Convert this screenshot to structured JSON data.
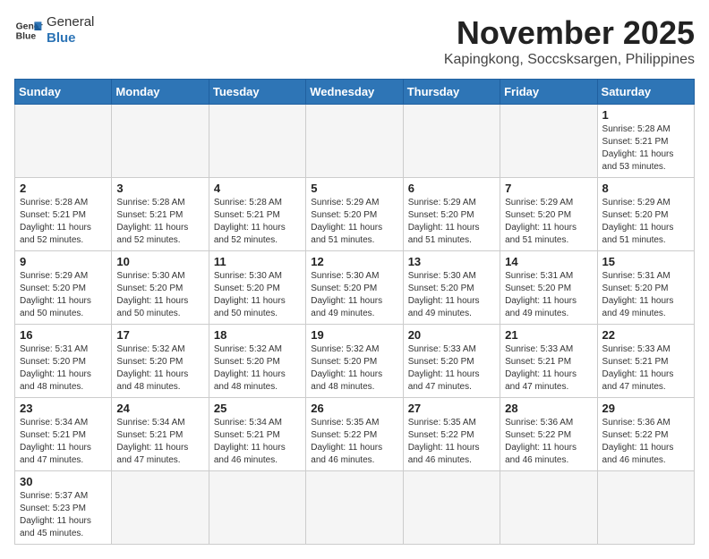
{
  "header": {
    "logo_text_normal": "General",
    "logo_text_bold": "Blue",
    "month_title": "November 2025",
    "location": "Kapingkong, Soccsksargen, Philippines"
  },
  "weekdays": [
    "Sunday",
    "Monday",
    "Tuesday",
    "Wednesday",
    "Thursday",
    "Friday",
    "Saturday"
  ],
  "weeks": [
    [
      {
        "day": "",
        "info": ""
      },
      {
        "day": "",
        "info": ""
      },
      {
        "day": "",
        "info": ""
      },
      {
        "day": "",
        "info": ""
      },
      {
        "day": "",
        "info": ""
      },
      {
        "day": "",
        "info": ""
      },
      {
        "day": "1",
        "info": "Sunrise: 5:28 AM\nSunset: 5:21 PM\nDaylight: 11 hours\nand 53 minutes."
      }
    ],
    [
      {
        "day": "2",
        "info": "Sunrise: 5:28 AM\nSunset: 5:21 PM\nDaylight: 11 hours\nand 52 minutes."
      },
      {
        "day": "3",
        "info": "Sunrise: 5:28 AM\nSunset: 5:21 PM\nDaylight: 11 hours\nand 52 minutes."
      },
      {
        "day": "4",
        "info": "Sunrise: 5:28 AM\nSunset: 5:21 PM\nDaylight: 11 hours\nand 52 minutes."
      },
      {
        "day": "5",
        "info": "Sunrise: 5:29 AM\nSunset: 5:20 PM\nDaylight: 11 hours\nand 51 minutes."
      },
      {
        "day": "6",
        "info": "Sunrise: 5:29 AM\nSunset: 5:20 PM\nDaylight: 11 hours\nand 51 minutes."
      },
      {
        "day": "7",
        "info": "Sunrise: 5:29 AM\nSunset: 5:20 PM\nDaylight: 11 hours\nand 51 minutes."
      },
      {
        "day": "8",
        "info": "Sunrise: 5:29 AM\nSunset: 5:20 PM\nDaylight: 11 hours\nand 51 minutes."
      }
    ],
    [
      {
        "day": "9",
        "info": "Sunrise: 5:29 AM\nSunset: 5:20 PM\nDaylight: 11 hours\nand 50 minutes."
      },
      {
        "day": "10",
        "info": "Sunrise: 5:30 AM\nSunset: 5:20 PM\nDaylight: 11 hours\nand 50 minutes."
      },
      {
        "day": "11",
        "info": "Sunrise: 5:30 AM\nSunset: 5:20 PM\nDaylight: 11 hours\nand 50 minutes."
      },
      {
        "day": "12",
        "info": "Sunrise: 5:30 AM\nSunset: 5:20 PM\nDaylight: 11 hours\nand 49 minutes."
      },
      {
        "day": "13",
        "info": "Sunrise: 5:30 AM\nSunset: 5:20 PM\nDaylight: 11 hours\nand 49 minutes."
      },
      {
        "day": "14",
        "info": "Sunrise: 5:31 AM\nSunset: 5:20 PM\nDaylight: 11 hours\nand 49 minutes."
      },
      {
        "day": "15",
        "info": "Sunrise: 5:31 AM\nSunset: 5:20 PM\nDaylight: 11 hours\nand 49 minutes."
      }
    ],
    [
      {
        "day": "16",
        "info": "Sunrise: 5:31 AM\nSunset: 5:20 PM\nDaylight: 11 hours\nand 48 minutes."
      },
      {
        "day": "17",
        "info": "Sunrise: 5:32 AM\nSunset: 5:20 PM\nDaylight: 11 hours\nand 48 minutes."
      },
      {
        "day": "18",
        "info": "Sunrise: 5:32 AM\nSunset: 5:20 PM\nDaylight: 11 hours\nand 48 minutes."
      },
      {
        "day": "19",
        "info": "Sunrise: 5:32 AM\nSunset: 5:20 PM\nDaylight: 11 hours\nand 48 minutes."
      },
      {
        "day": "20",
        "info": "Sunrise: 5:33 AM\nSunset: 5:20 PM\nDaylight: 11 hours\nand 47 minutes."
      },
      {
        "day": "21",
        "info": "Sunrise: 5:33 AM\nSunset: 5:21 PM\nDaylight: 11 hours\nand 47 minutes."
      },
      {
        "day": "22",
        "info": "Sunrise: 5:33 AM\nSunset: 5:21 PM\nDaylight: 11 hours\nand 47 minutes."
      }
    ],
    [
      {
        "day": "23",
        "info": "Sunrise: 5:34 AM\nSunset: 5:21 PM\nDaylight: 11 hours\nand 47 minutes."
      },
      {
        "day": "24",
        "info": "Sunrise: 5:34 AM\nSunset: 5:21 PM\nDaylight: 11 hours\nand 47 minutes."
      },
      {
        "day": "25",
        "info": "Sunrise: 5:34 AM\nSunset: 5:21 PM\nDaylight: 11 hours\nand 46 minutes."
      },
      {
        "day": "26",
        "info": "Sunrise: 5:35 AM\nSunset: 5:22 PM\nDaylight: 11 hours\nand 46 minutes."
      },
      {
        "day": "27",
        "info": "Sunrise: 5:35 AM\nSunset: 5:22 PM\nDaylight: 11 hours\nand 46 minutes."
      },
      {
        "day": "28",
        "info": "Sunrise: 5:36 AM\nSunset: 5:22 PM\nDaylight: 11 hours\nand 46 minutes."
      },
      {
        "day": "29",
        "info": "Sunrise: 5:36 AM\nSunset: 5:22 PM\nDaylight: 11 hours\nand 46 minutes."
      }
    ],
    [
      {
        "day": "30",
        "info": "Sunrise: 5:37 AM\nSunset: 5:23 PM\nDaylight: 11 hours\nand 45 minutes."
      },
      {
        "day": "",
        "info": ""
      },
      {
        "day": "",
        "info": ""
      },
      {
        "day": "",
        "info": ""
      },
      {
        "day": "",
        "info": ""
      },
      {
        "day": "",
        "info": ""
      },
      {
        "day": "",
        "info": ""
      }
    ]
  ]
}
